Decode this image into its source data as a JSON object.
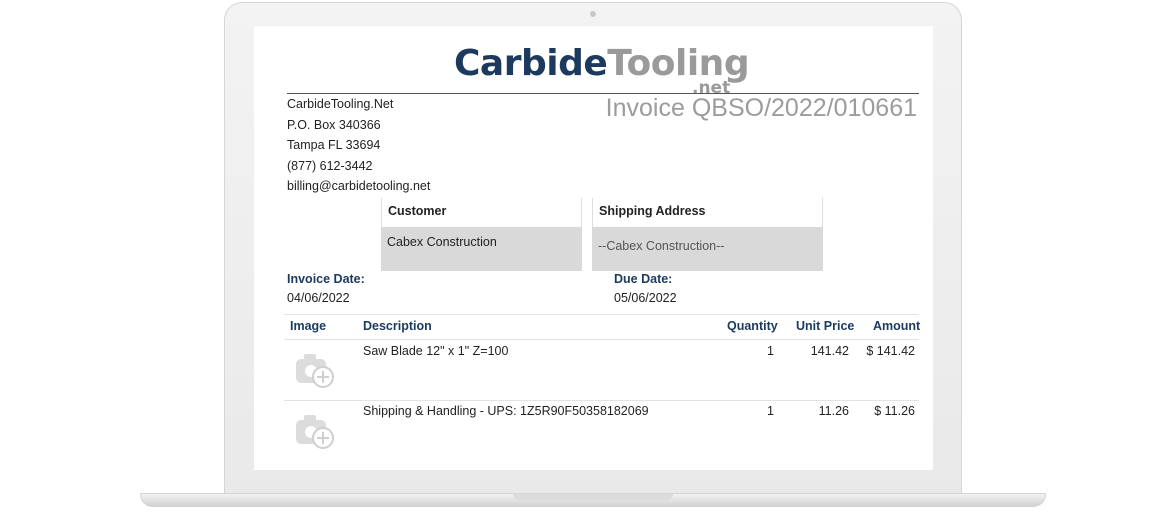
{
  "brand": {
    "logo_part1": "Carbide",
    "logo_part2": "Tooling",
    "logo_sub": ".net"
  },
  "invoice": {
    "title": "Invoice QBSO/2022/010661"
  },
  "company": {
    "name": "CarbideTooling.Net",
    "po_box": "P.O. Box 340366",
    "city": "Tampa FL 33694",
    "phone": "(877) 612-3442",
    "email": "billing@carbidetooling.net"
  },
  "customer": {
    "label": "Customer",
    "value": "Cabex Construction"
  },
  "shipping": {
    "label": "Shipping Address",
    "value": "--Cabex Construction--"
  },
  "dates": {
    "invoice_label": "Invoice Date:",
    "invoice_value": "04/06/2022",
    "due_label": "Due Date:",
    "due_value": "05/06/2022"
  },
  "table": {
    "headers": [
      "Image",
      "Description",
      "Quantity",
      "Unit Price",
      "Amount"
    ],
    "rows": [
      {
        "description": "Saw Blade 12\" x 1\" Z=100",
        "quantity": "1",
        "unit_price": "141.42",
        "amount": "$ 141.42",
        "image_icon": "camera-add-icon"
      },
      {
        "description": "Shipping & Handling - UPS: 1Z5R90F50358182069",
        "quantity": "1",
        "unit_price": "11.26",
        "amount": "$ 11.26",
        "image_icon": "camera-add-icon"
      }
    ]
  },
  "colors": {
    "accent": "#1c3a5e",
    "muted": "#9c9c9c",
    "box_fill": "#d9d9d9"
  }
}
